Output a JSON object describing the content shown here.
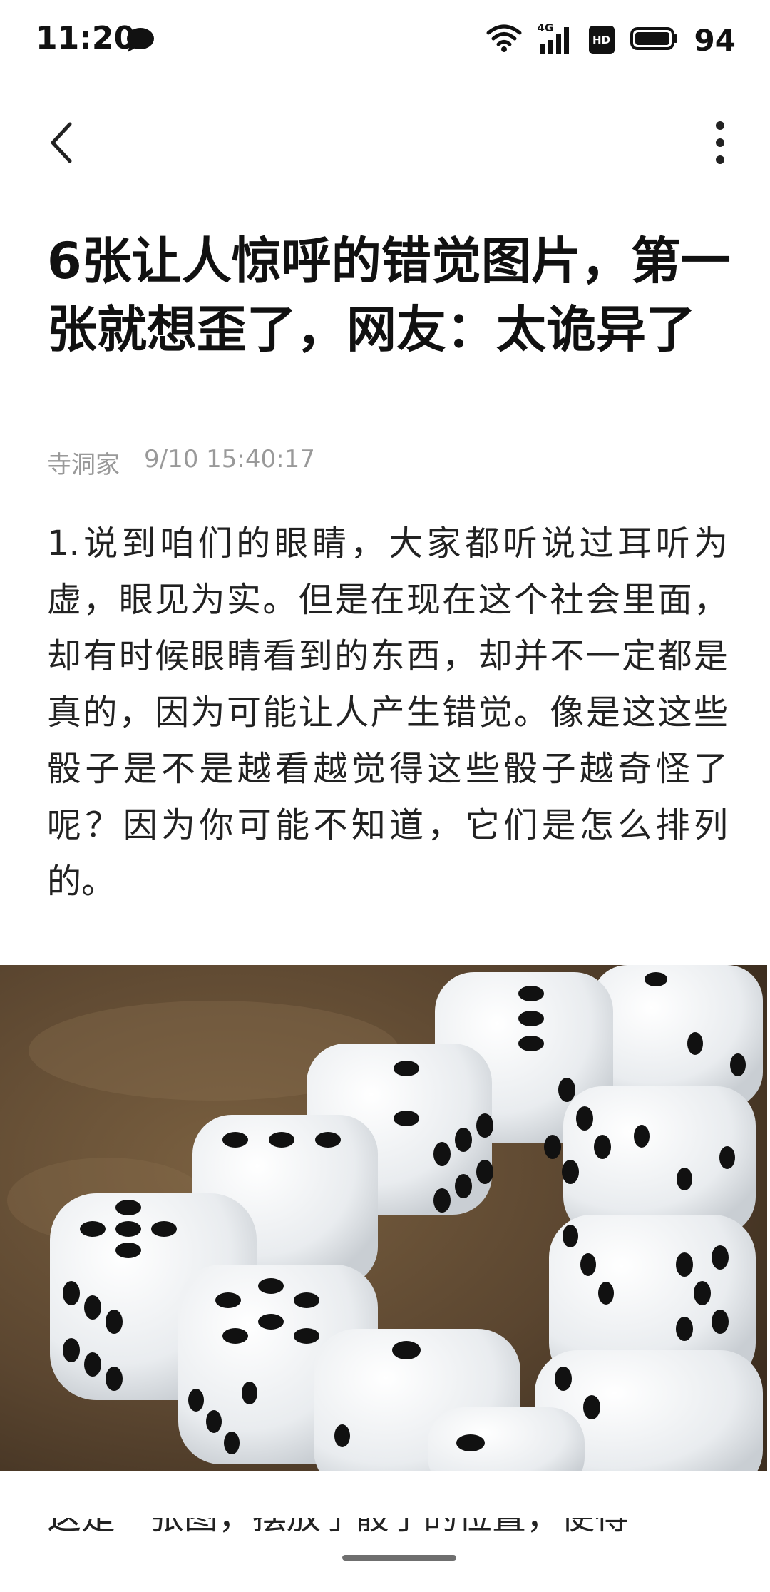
{
  "status_bar": {
    "time": "11:20",
    "battery": "94",
    "network_label": "4G",
    "hd_label": "HD",
    "icons": [
      "chat-bubble-icon",
      "wifi-icon",
      "signal-icon",
      "hd-icon",
      "battery-icon"
    ]
  },
  "nav": {
    "back_icon": "chevron-left-icon",
    "more_icon": "more-vertical-icon"
  },
  "article": {
    "title": "6张让人惊呼的错觉图片，第一张就想歪了，网友：太诡异了",
    "author": "寺洞家",
    "datetime": "9/10 15:40:17",
    "paragraph": "1.说到咱们的眼睛，大家都听说过耳听为虚，眼见为实。但是在现在这个社会里面，却有时候眼睛看到的东西，却并不一定都是真的，因为可能让人产生错觉。像是这这些骰子是不是越看越觉得这些骰子越奇怪了呢？因为你可能不知道，它们是怎么排列的。",
    "next_paragraph_partial": "这是一张图，摆放了骰子的位置，使得"
  },
  "colors": {
    "background": "#ffffff",
    "text": "#111111",
    "meta": "#999999",
    "table": "#5b4630"
  }
}
